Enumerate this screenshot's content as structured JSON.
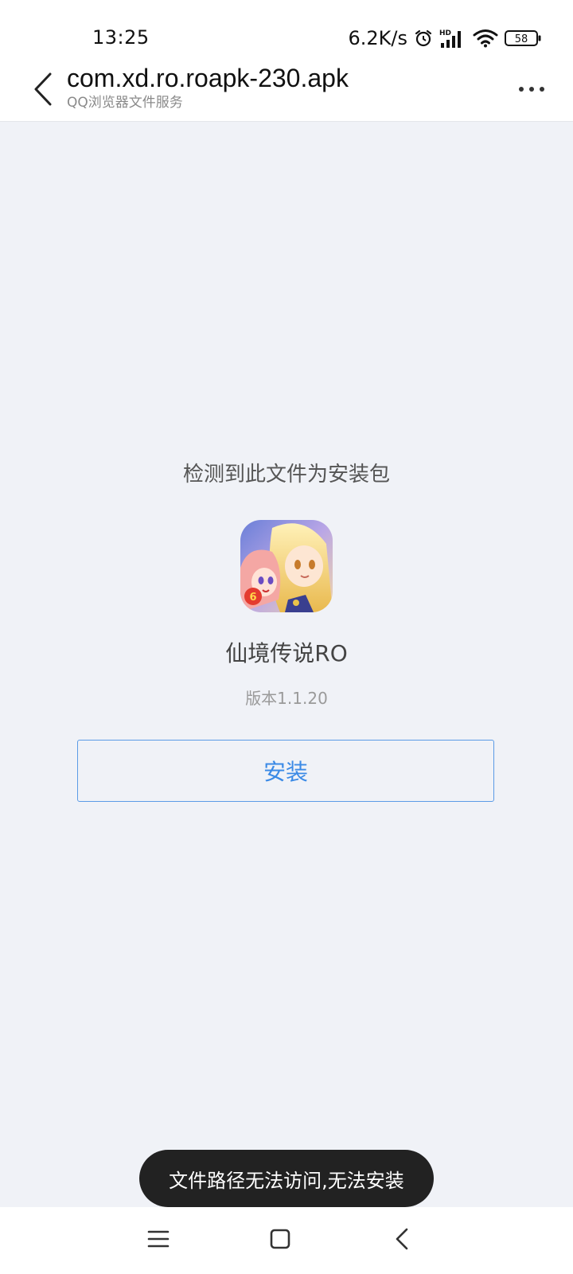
{
  "status_bar": {
    "time": "13:25",
    "net_speed": "6.2K/s",
    "battery": "58",
    "icons": [
      "alarm-icon",
      "hd-signal-icon",
      "wifi-icon",
      "battery-icon"
    ]
  },
  "header": {
    "title": "com.xd.ro.roapk-230.apk",
    "subtitle": "QQ浏览器文件服务",
    "back_icon": "chevron-left-icon",
    "more_icon": "more-horizontal-icon"
  },
  "main": {
    "detect_text": "检测到此文件为安装包",
    "app_name": "仙境传说RO",
    "version": "版本1.1.20",
    "install_label": "安装"
  },
  "toast": {
    "message": "文件路径无法访问,无法安装"
  },
  "nav": {
    "icons": [
      "menu-icon",
      "home-square-icon",
      "back-chevron-icon"
    ]
  },
  "colors": {
    "accent": "#3b8ae6",
    "background": "#f0f2f7",
    "toast_bg": "#222222"
  }
}
